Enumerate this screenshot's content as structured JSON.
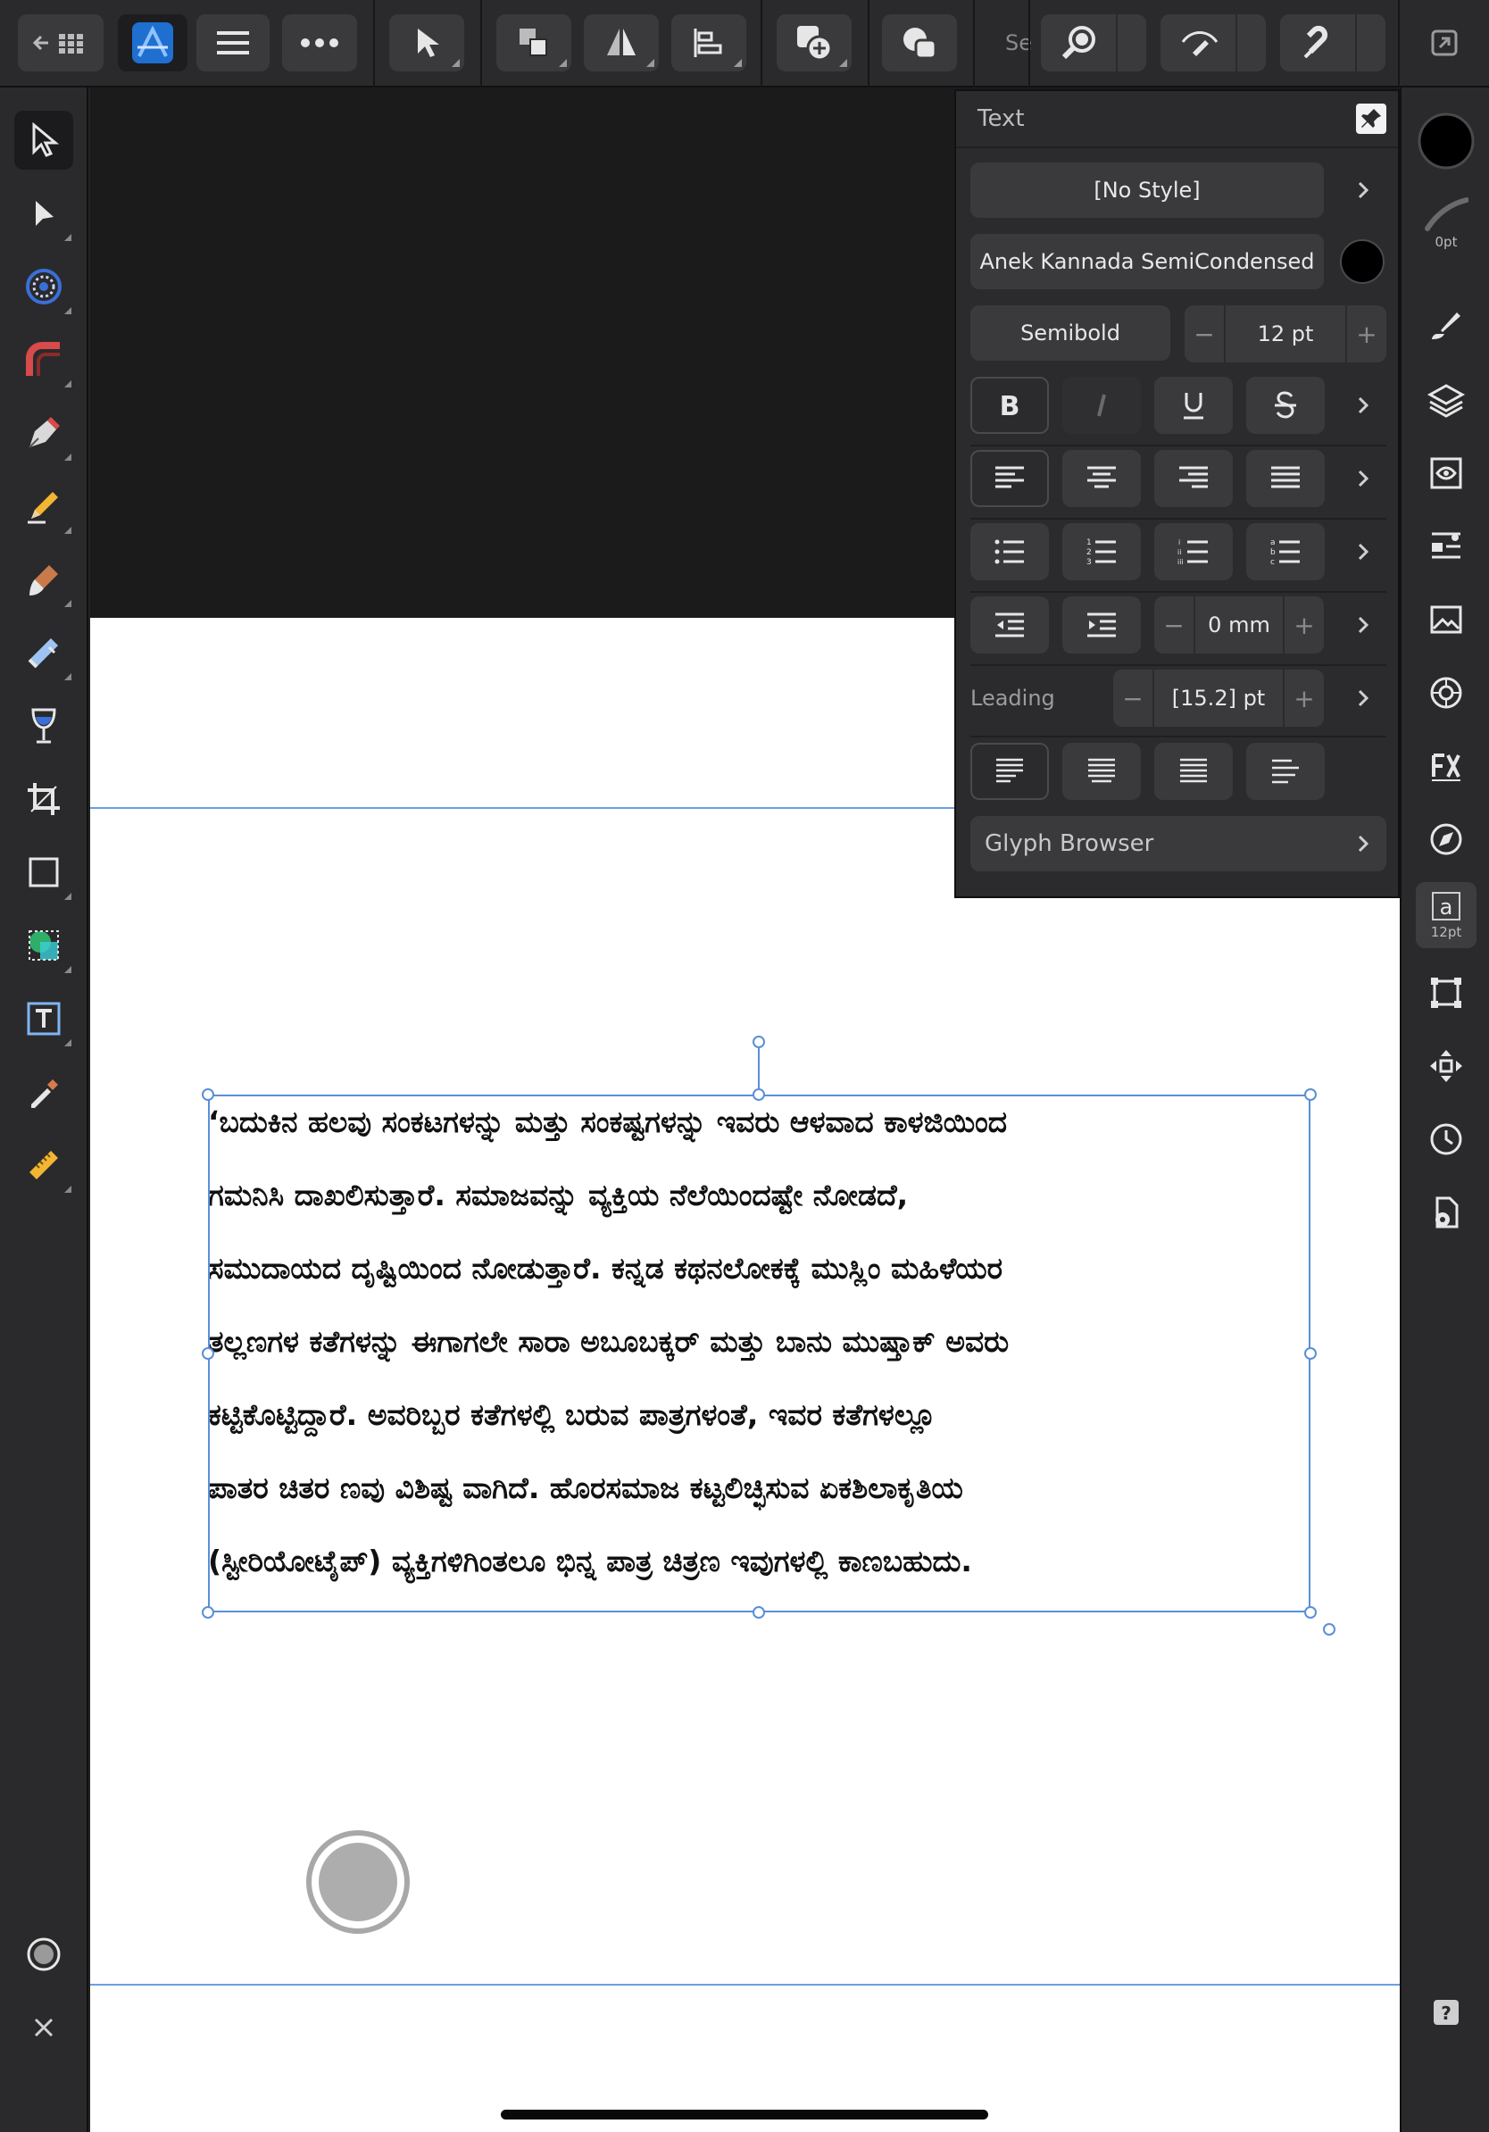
{
  "toolbar": {
    "search_label": "Se"
  },
  "text_panel": {
    "title": "Text",
    "style": "[No Style]",
    "font_family": "Anek Kannada SemiCondensed",
    "font_color": "#000000",
    "font_weight": "Semibold",
    "font_size": "12 pt",
    "indent_value": "0 mm",
    "leading_label": "Leading",
    "leading_value": "[15.2] pt",
    "glyph_browser": "Glyph Browser",
    "minus": "−",
    "plus": "+"
  },
  "right_column": {
    "stroke_width": "0pt",
    "text_size_badge": "12pt"
  },
  "document": {
    "lines": [
      "‘ಬದುಕಿನ ಹಲವು ಸಂಕಟಗಳನ್ನು ಮತ್ತು ಸಂಕಷ್ಟಗಳನ್ನು ಇವರು ಆಳವಾದ ಕಾಳಜಿಯಿಂದ",
      "ಗಮನಿಸಿ ದಾಖಲಿಸುತ್ತಾರೆ. ಸಮಾಜವನ್ನು ವ್ಯಕ್ತಿಯ ನೆಲೆಯಿಂದಷ್ಟೇ ನೋಡದೆ,",
      "ಸಮುದಾಯದ ದೃಷ್ಟಿಯಿಂದ ನೋಡುತ್ತಾರೆ. ಕನ್ನಡ ಕಥನಲೋಕಕ್ಕೆ ಮುಸ್ಲಿಂ ಮಹಿಳೆಯರ",
      "ತಲ್ಲಣಗಳ ಕತೆಗಳನ್ನು ಈಗಾಗಲೇ ಸಾರಾ ಅಬೂಬಕ್ಕರ್ ಮತ್ತು ಬಾನು ಮುಷ್ತಾಕ್ ಅವರು",
      "ಕಟ್ಟಿಕೊಟ್ಟಿದ್ದಾರೆ. ಅವರಿಬ್ಬರ ಕತೆಗಳಲ್ಲಿ ಬರುವ ಪಾತ್ರಗಳಂತೆ, ಇವರ ಕತೆಗಳಲ್ಲೂ",
      "ಪಾತರ ಚಿತರ ಣವು ವಿಶಿಷ್ಟ ವಾಗಿದೆ. ಹೊರಸಮಾಜ ಕಟ್ಟಲಿಚ್ಛಿಸುವ ಏಕಶಿಲಾಕೃತಿಯ",
      "(ಸ್ಟೀರಿಯೋಟೈಪ್) ವ್ಯಕ್ತಿಗಳಿಗಿಂತಲೂ ಭಿನ್ನ ಪಾತ್ರ ಚಿತ್ರಣ ಇವುಗಳಲ್ಲಿ ಕಾಣಬಹುದು."
    ]
  },
  "colors": {
    "accent_blue": "#2f7de1",
    "selection": "#5b8fd6",
    "ui_dark": "#2a2a2c"
  }
}
